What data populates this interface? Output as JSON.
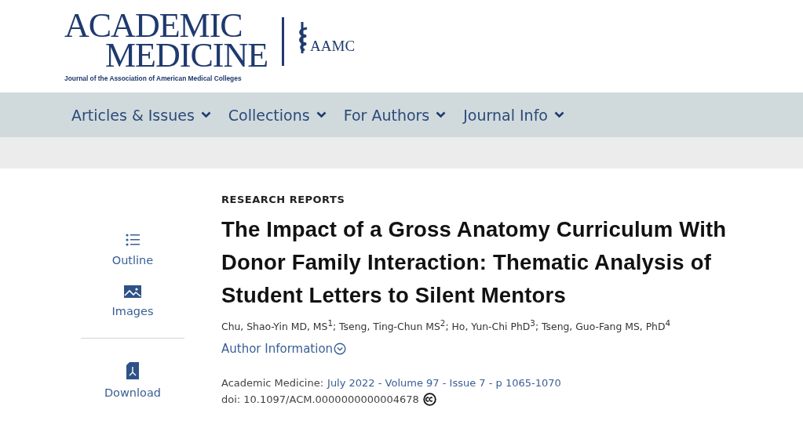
{
  "logo": {
    "line_1": "ACADEMIC",
    "line_2": "MEDICINE",
    "tagline": "Journal of the Association of American Medical Colleges",
    "partner": "AAMC"
  },
  "nav": [
    {
      "label": "Articles & Issues"
    },
    {
      "label": "Collections"
    },
    {
      "label": "For Authors"
    },
    {
      "label": "Journal Info"
    }
  ],
  "sidebar": {
    "tools": [
      {
        "kind": "outline",
        "label": "Outline"
      },
      {
        "kind": "images",
        "label": "Images"
      },
      {
        "kind": "download",
        "label": "Download"
      }
    ]
  },
  "article": {
    "section": "RESEARCH REPORTS",
    "title": "The Impact of a Gross Anatomy Curriculum With Donor Family Interaction: Thematic Analysis of Student Letters to Silent Mentors",
    "authors": "Chu, Shao-Yin MD, MS$^{1}$; Tseng, Ting-Chun MS$^{2}$; Ho, Yun-Chi PhD$^{3}$; Tseng, Guo-Fang MS, PhD$^{4}$",
    "author_info": "Author Information",
    "journal": "Academic Medicine:",
    "issue_link": "July 2022 - Volume 97 - Issue 7 - p 1065-1070",
    "doi": "doi: 10.1097/ACM.0000000000004678"
  }
}
